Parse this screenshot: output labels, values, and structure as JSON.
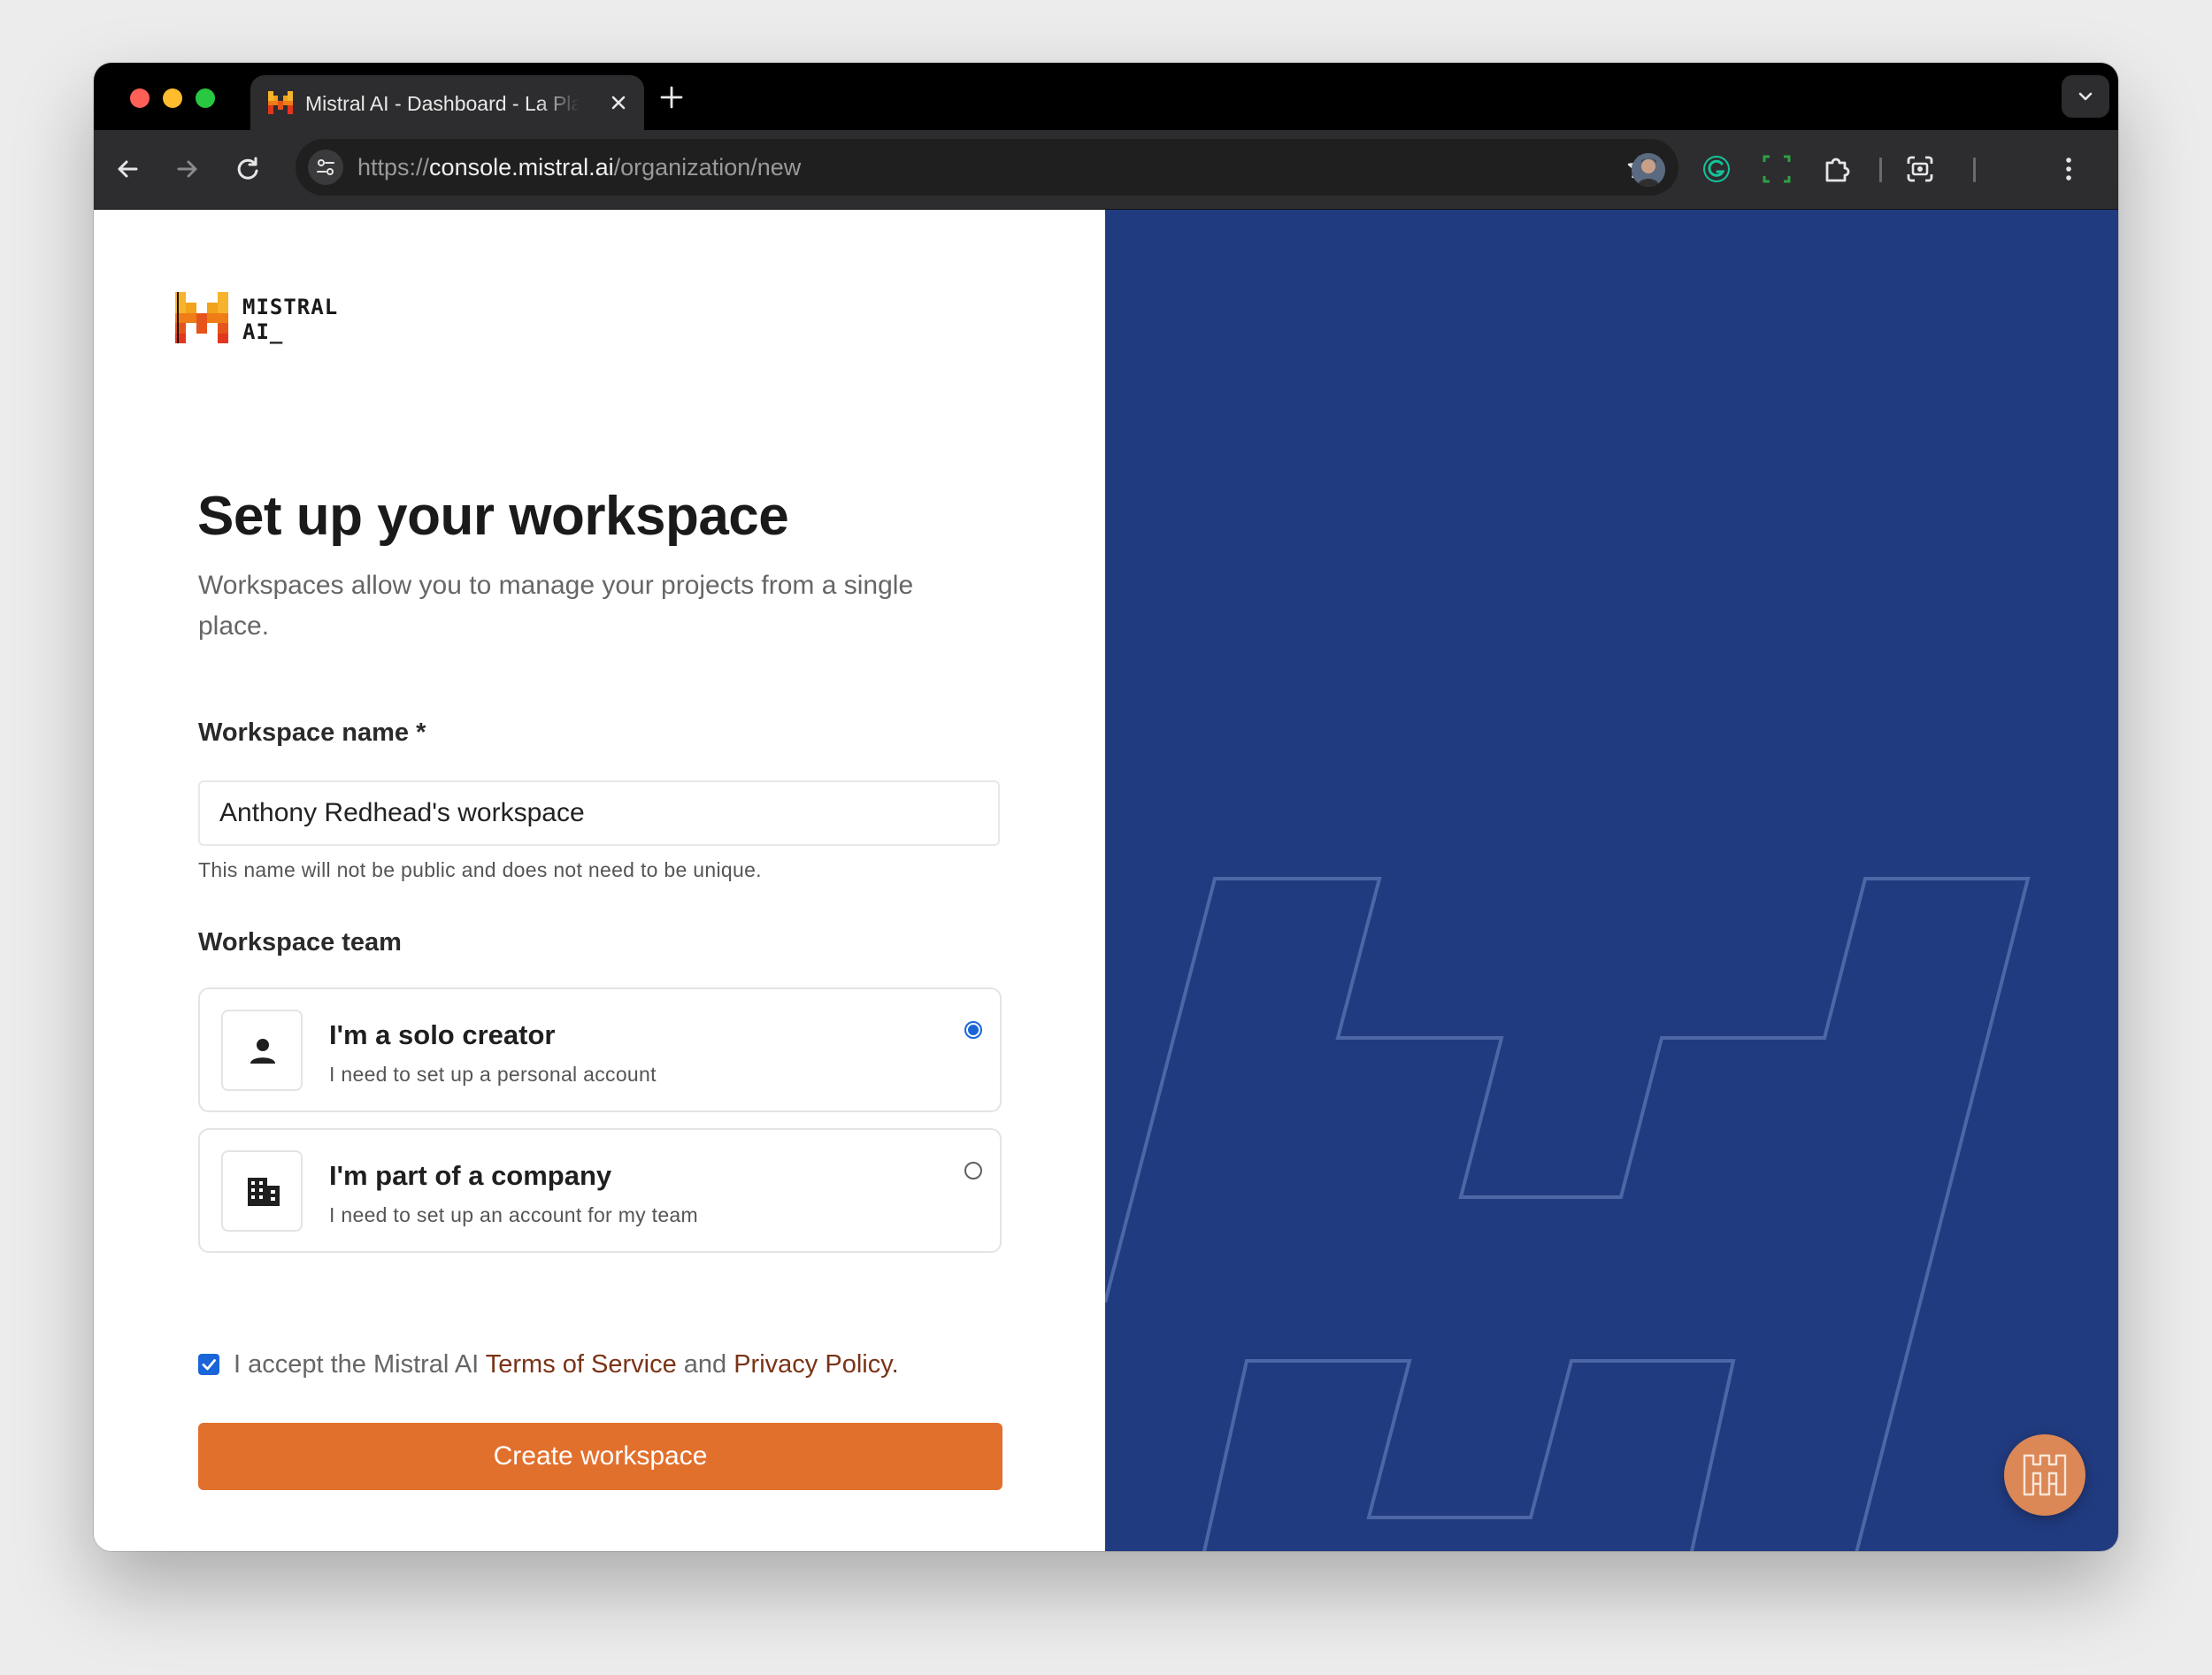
{
  "browser": {
    "tab": {
      "title": "Mistral AI - Dashboard - La Plateforme",
      "favicon": "mistral-logo-icon"
    },
    "address_bar": {
      "scheme": "https://",
      "host": "console.mistral.ai",
      "path": "/organization/new"
    },
    "toolbar_icons": [
      "back-icon",
      "forward-icon",
      "reload-icon",
      "site-settings-icon",
      "bookmark-star-icon",
      "grammarly-icon",
      "screenshot-extension-icon",
      "extensions-icon",
      "google-lens-icon",
      "profile-avatar",
      "menu-icon"
    ]
  },
  "brand": {
    "logo_text_line1": "MISTRAL",
    "logo_text_line2": "AI_"
  },
  "page": {
    "title": "Set up your workspace",
    "subtitle": "Workspaces allow you to manage your projects from a single place."
  },
  "form": {
    "name_label": "Workspace name *",
    "name_value": "Anthony Redhead's workspace",
    "name_helper": "This name will not be public and does not need to be unique.",
    "team_label": "Workspace team",
    "options": [
      {
        "title": "I'm a solo creator",
        "description": "I need to set up a personal account",
        "icon": "person-icon",
        "selected": true
      },
      {
        "title": "I'm part of a company",
        "description": "I need to set up an account for my team",
        "icon": "building-icon",
        "selected": false
      }
    ],
    "accept": {
      "checked": true,
      "prefix": "I accept the Mistral AI ",
      "terms_link": "Terms of Service",
      "conjunction": " and ",
      "privacy_link": "Privacy Policy",
      "suffix": "."
    },
    "submit_label": "Create workspace"
  },
  "colors": {
    "accent_orange": "#e2702d",
    "panel_blue": "#213b80",
    "radio_blue": "#1a66d9",
    "link_brown": "#7a3316"
  }
}
